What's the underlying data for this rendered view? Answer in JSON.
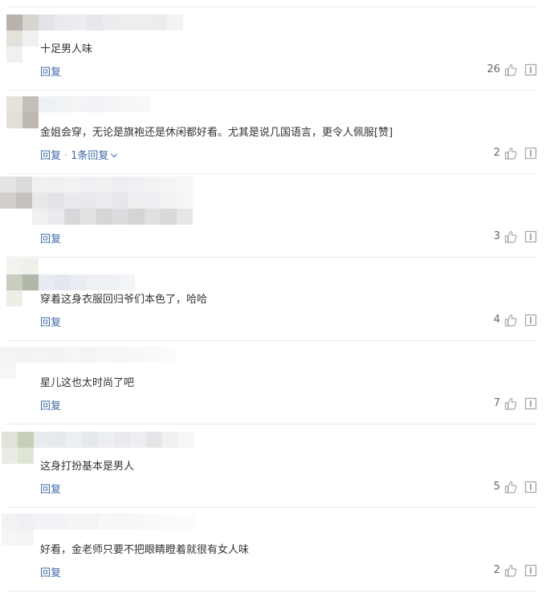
{
  "labels": {
    "reply": "回复",
    "separator": "·"
  },
  "colors": {
    "link": "#3f6aa8",
    "text": "#333333",
    "icon": "#a8a8a8",
    "divider": "#e9e9e9"
  },
  "comments": [
    {
      "text": "十足男人味",
      "likes": "26",
      "reply_count": ""
    },
    {
      "text": "金姐会穿，无论是旗袍还是休闲都好看。尤其是说几国语言，更令人佩服[赞]",
      "likes": "2",
      "reply_count": "1条回复"
    },
    {
      "text": "",
      "likes": "3",
      "reply_count": ""
    },
    {
      "text": "穿着这身衣服回归爷们本色了，哈哈",
      "likes": "4",
      "reply_count": ""
    },
    {
      "text": "星儿这也太时尚了吧",
      "likes": "7",
      "reply_count": ""
    },
    {
      "text": "这身打扮基本是男人",
      "likes": "5",
      "reply_count": ""
    },
    {
      "text": "好看，金老师只要不把眼睛瞪着就很有女人味",
      "likes": "2",
      "reply_count": ""
    }
  ]
}
